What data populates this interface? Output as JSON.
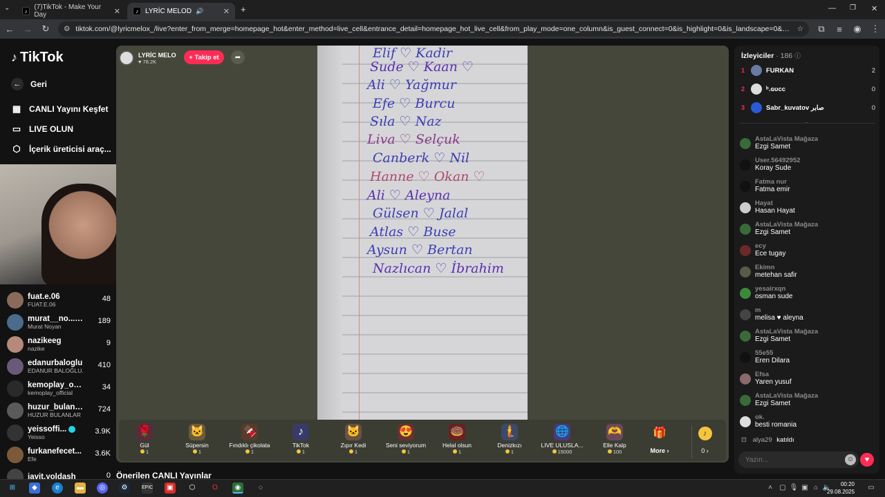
{
  "browser": {
    "tab1": "(7)TikTok - Make Your Day",
    "tab2": "LYRİC MELOD",
    "url": "tiktok.com/@lyricmelox_/live?enter_from_merge=homepage_hot&enter_method=live_cell&entrance_detail=homepage_hot_live_cell&from_play_mode=one_column&is_guest_connect=0&is_highlight=0&is_landscape=0&request_id=2025082905175..."
  },
  "nav": {
    "logo": "TikTok",
    "back": "Geri",
    "explore": "CANLI Yayını Keşfet",
    "go_live": "LIVE OLUN",
    "creator_tools": "İçerik üreticisi araç..."
  },
  "creators": [
    {
      "name": "fuat.e.06",
      "sub": "FUAT.E.06",
      "count": "48"
    },
    {
      "name": "murat__no...",
      "sub": "Murat Noyan",
      "count": "189"
    },
    {
      "name": "nazikeeg",
      "sub": "nazike",
      "count": "9"
    },
    {
      "name": "edanurbaloglu",
      "sub": "EDANUR BALOĞLU...",
      "count": "410"
    },
    {
      "name": "kemoplay_off...",
      "sub": "kemoplay_official",
      "count": "34"
    },
    {
      "name": "huzur_bulanlar",
      "sub": "HUZUR BULANLAR",
      "count": "724"
    },
    {
      "name": "yeissoffi...",
      "sub": "Yeisso",
      "count": "3.9K"
    },
    {
      "name": "furkanefecet...",
      "sub": "Efe",
      "count": "3.6K"
    },
    {
      "name": "javit.yoldash",
      "sub": "",
      "count": "0"
    }
  ],
  "stream": {
    "name": "LYRİC MELO",
    "likes": "78.2K",
    "follow": "+ Takip et"
  },
  "notebook": [
    "Elif ♡ Kadir",
    "Sude ♡ Kaan ♡",
    "Ali ♡ Yağmur",
    "Efe ♡ Burcu",
    "Sıla ♡ Naz",
    "Liva ♡ Selçuk",
    "Canberk ♡ Nil",
    "Hanne ♡ Okan ♡",
    "Ali ♡ Aleyna",
    "Gülsen ♡ Jalal",
    "Atlas ♡ Buse",
    "Aysun ♡ Bertan",
    "Nazlıcan ♡ İbrahim"
  ],
  "gifts": [
    {
      "name": "Gül",
      "price": "1",
      "icon": "🌹"
    },
    {
      "name": "Süpersin",
      "price": "1",
      "icon": "🐱"
    },
    {
      "name": "Fındıklı çikolata",
      "price": "1",
      "icon": "🍫"
    },
    {
      "name": "TikTok",
      "price": "1",
      "icon": "♪"
    },
    {
      "name": "Zıpır Kedi",
      "price": "1",
      "icon": "🐱"
    },
    {
      "name": "Seni seviyorum",
      "price": "1",
      "icon": "😍"
    },
    {
      "name": "Helal olsun",
      "price": "1",
      "icon": "🍩"
    },
    {
      "name": "Denizkızı",
      "price": "1",
      "icon": "🧜"
    },
    {
      "name": "LIVE ULUSLA...",
      "price": "15000",
      "icon": "🌐"
    },
    {
      "name": "Elle Kalp",
      "price": "100",
      "icon": "🫶"
    }
  ],
  "gift_more": "More ›",
  "coins": "0 ›",
  "bottom_title": "Önerilen CANLI Yayınlar",
  "viewers": {
    "title": "İzleyiciler",
    "count": "· 186",
    "list": [
      {
        "rank": "1",
        "name": "FURKAN",
        "score": "2"
      },
      {
        "rank": "2",
        "name": "ᵇ.ɢᴜᴄᴄ",
        "score": "0"
      },
      {
        "rank": "3",
        "name": "Sabr_kuvatov صابر",
        "score": "0"
      }
    ]
  },
  "chat": [
    {
      "user": "AstaLaVista Mağaza",
      "msg": "Ezgi Samet"
    },
    {
      "user": "User.56492952",
      "msg": "Koray Sude"
    },
    {
      "user": "Fatma nur",
      "msg": "Fatma emir"
    },
    {
      "user": "Hayat",
      "msg": "Hasan Hayat"
    },
    {
      "user": "AstaLaVista Mağaza",
      "msg": "Ezgi Samet"
    },
    {
      "user": "ecy",
      "msg": "Ece tugay"
    },
    {
      "user": "Ekimn",
      "msg": "metehan safir"
    },
    {
      "user": "yesairxqn",
      "msg": "osman sude"
    },
    {
      "user": "m",
      "msg": "melisa ♥ aleyna"
    },
    {
      "user": "AstaLaVista Mağaza",
      "msg": "Ezgi Samet"
    },
    {
      "user": "55e55",
      "msg": "Eren Dilara"
    },
    {
      "user": "Efsa",
      "msg": "Yaren yusuf"
    },
    {
      "user": "AstaLaVista Mağaza",
      "msg": "Ezgi Samet"
    },
    {
      "user": "ok.",
      "msg": "besti romania"
    }
  ],
  "joined_user": "alya29",
  "joined_text": "katıldı",
  "chat_placeholder": "Yazın...",
  "clock": {
    "time": "00:20",
    "date": "29.08.2025"
  }
}
